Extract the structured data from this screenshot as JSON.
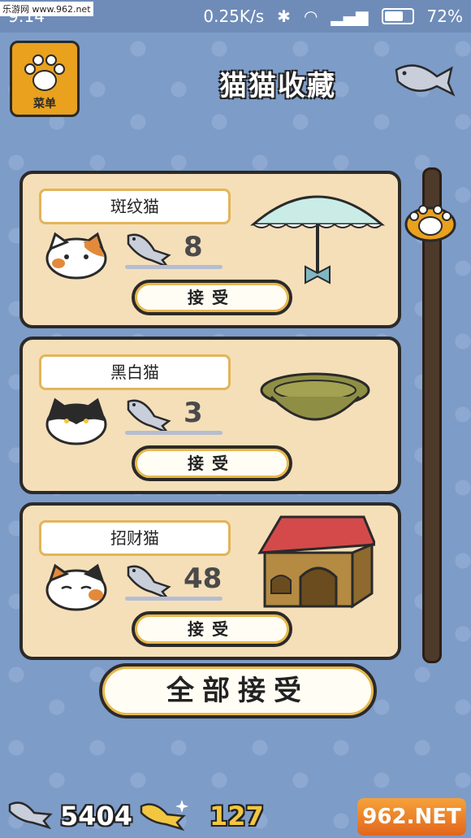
{
  "status_bar": {
    "time": "9:14",
    "watermark": "乐游网 www.962.net",
    "network_speed": "0.25K/s",
    "battery": "72%"
  },
  "header": {
    "menu_label": "菜单",
    "title": "猫猫收藏"
  },
  "cards": [
    {
      "name": "斑纹猫",
      "fish_count": "8",
      "accept_label": "接受",
      "gift": "umbrella"
    },
    {
      "name": "黑白猫",
      "fish_count": "3",
      "accept_label": "接受",
      "gift": "bowl"
    },
    {
      "name": "招财猫",
      "fish_count": "48",
      "accept_label": "接受",
      "gift": "cat-house"
    }
  ],
  "accept_all_label": "全部接受",
  "footer": {
    "silver_fish_count": "5404",
    "gold_fish_count": "127",
    "site_logo": "962.NET"
  },
  "colors": {
    "background": "#7d9cc8",
    "card": "#f5dfb9",
    "accent": "#e9a11e"
  }
}
